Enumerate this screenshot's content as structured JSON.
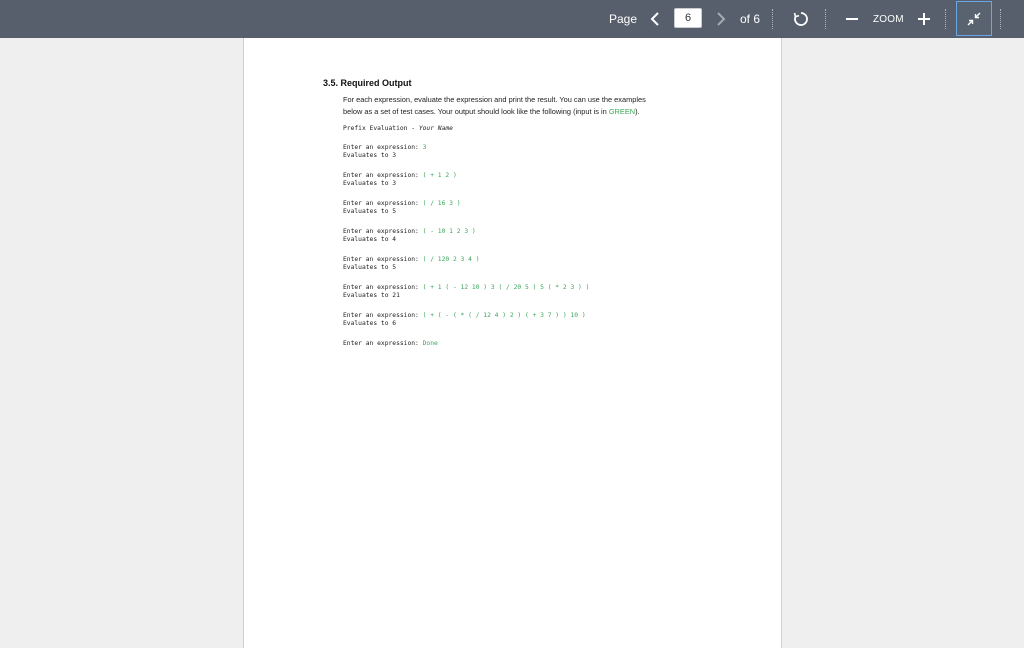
{
  "toolbar": {
    "page_label": "Page",
    "page_value": "6",
    "of_label": "of 6",
    "zoom_label": "ZOOM",
    "icons": {
      "prev": "chevron-left-icon",
      "next": "chevron-right-icon",
      "rotate": "rotate-icon",
      "zoom_out": "minus-icon",
      "zoom_in": "plus-icon",
      "fit": "collapse-icon"
    },
    "colors": {
      "bar": "#565f6b",
      "fit_border": "#6aa6e8"
    }
  },
  "document": {
    "heading": "3.5. Required Output",
    "para_line1": "For each expression, evaluate the expression and print the result. You can use the examples",
    "para_line2_pre": "below as a set of test cases. Your output should look like the following (input is in ",
    "para_line2_green": "GREEN",
    "para_line2_post": ").",
    "title_prefix": "Prefix Evaluation - ",
    "title_name": "Your Name",
    "prompt": "Enter an expression: ",
    "samples": [
      {
        "input": "3",
        "result": "Evaluates to 3"
      },
      {
        "input": "( + 1 2 )",
        "result": "Evaluates to 3"
      },
      {
        "input": "( / 16 3 )",
        "result": "Evaluates to 5"
      },
      {
        "input": "( - 10 1 2 3 )",
        "result": "Evaluates to 4"
      },
      {
        "input": "( / 120 2 3 4 )",
        "result": "Evaluates to 5"
      },
      {
        "input": "( + 1 ( - 12 10 ) 3 ( / 20 5 ) 5 ( * 2 3 ) )",
        "result": "Evaluates to 21"
      },
      {
        "input": "( + ( - ( * ( / 12 4 ) 2 ) ( + 3 7 ) ) 10 )",
        "result": "Evaluates to 6"
      }
    ],
    "final_input": "Done",
    "accent_green": "#3aa55a"
  }
}
